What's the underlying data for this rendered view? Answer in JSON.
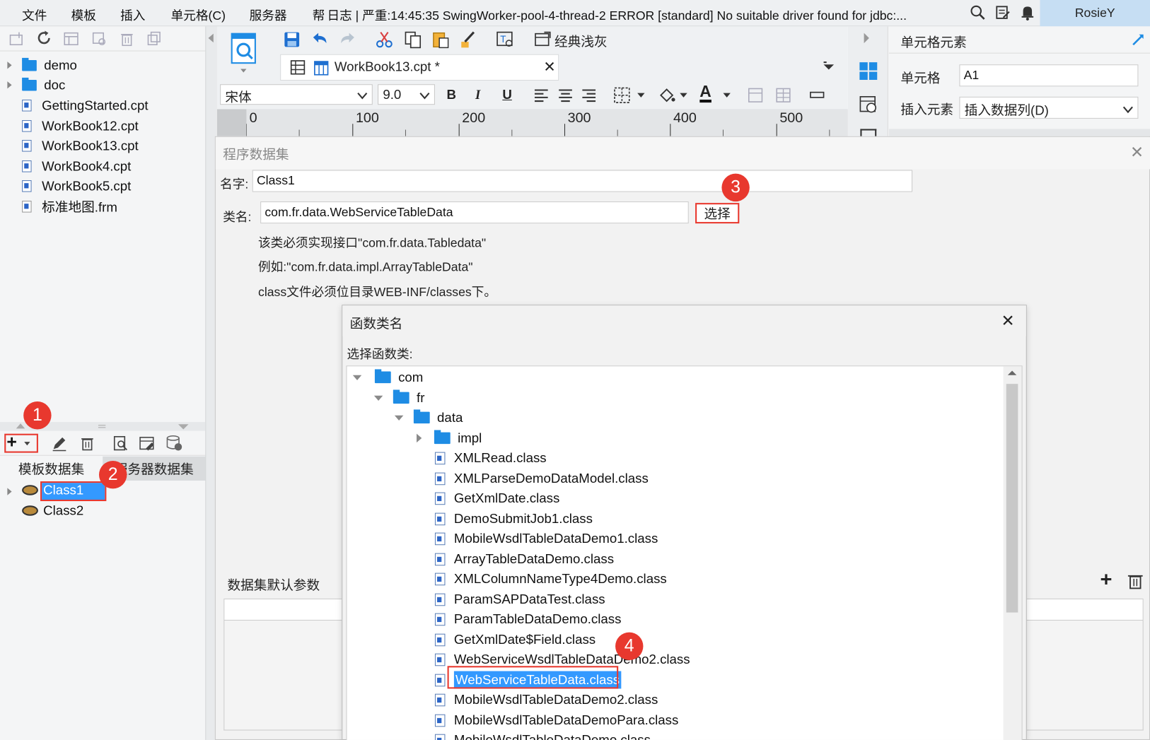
{
  "menubar": {
    "items": [
      "文件",
      "模板",
      "插入",
      "单元格(C)",
      "服务器",
      "帮"
    ],
    "log_text": "日志 | 严重:14:45:35 SwingWorker-pool-4-thread-2 ERROR [standard] No suitable driver found for jdbc:...",
    "user": "RosieY"
  },
  "file_tree": {
    "folders": [
      "demo",
      "doc"
    ],
    "files": [
      "GettingStarted.cpt",
      "WorkBook12.cpt",
      "WorkBook13.cpt",
      "WorkBook4.cpt",
      "WorkBook5.cpt",
      "标准地图.frm"
    ]
  },
  "editor": {
    "tab_title": "WorkBook13.cpt *",
    "theme_label": "经典浅灰",
    "font_name": "宋体",
    "font_size": "9.0",
    "bold": "B",
    "italic": "I",
    "underline": "U",
    "font_color_glyph": "A",
    "ruler": [
      "0",
      "100",
      "200",
      "300",
      "400",
      "500"
    ]
  },
  "dataset_panel": {
    "tabs": [
      "模板数据集",
      "服务器数据集"
    ],
    "items": [
      "Class1",
      "Class2"
    ]
  },
  "right_panel": {
    "title": "单元格元素",
    "cell_label": "单元格",
    "cell_value": "A1",
    "insert_label": "插入元素",
    "insert_value": "插入数据列(D)"
  },
  "program_dialog": {
    "title": "程序数据集",
    "name_label": "名字:",
    "name_value": "Class1",
    "class_label": "类名:",
    "class_value": "com.fr.data.WebServiceTableData",
    "select_button": "选择",
    "hint1": "该类必须实现接口\"com.fr.data.Tabledata\"",
    "hint2": "例如:\"com.fr.data.impl.ArrayTableData\"",
    "hint3": "class文件必须位目录WEB-INF/classes下。",
    "params_label": "数据集默认参数"
  },
  "class_dialog": {
    "title": "函数类名",
    "subtitle": "选择函数类:",
    "folders": [
      "com",
      "fr",
      "data",
      "impl"
    ],
    "classes": [
      "XMLRead.class",
      "XMLParseDemoDataModel.class",
      "GetXmlDate.class",
      "DemoSubmitJob1.class",
      "MobileWsdlTableDataDemo1.class",
      "ArrayTableDataDemo.class",
      "XMLColumnNameType4Demo.class",
      "ParamSAPDataTest.class",
      "ParamTableDataDemo.class",
      "GetXmlDate$Field.class",
      "WebServiceWsdlTableDataDemo2.class",
      "WebServiceTableData.class",
      "MobileWsdlTableDataDemo2.class",
      "MobileWsdlTableDataDemoPara.class",
      "MobileWsdlTableDataDemo.class"
    ],
    "selected": "WebServiceTableData.class"
  },
  "badges": [
    "1",
    "2",
    "3",
    "4"
  ],
  "colors": {
    "accent": "#1e8ce4",
    "badge": "#e8382e",
    "selection": "#3399ff"
  }
}
